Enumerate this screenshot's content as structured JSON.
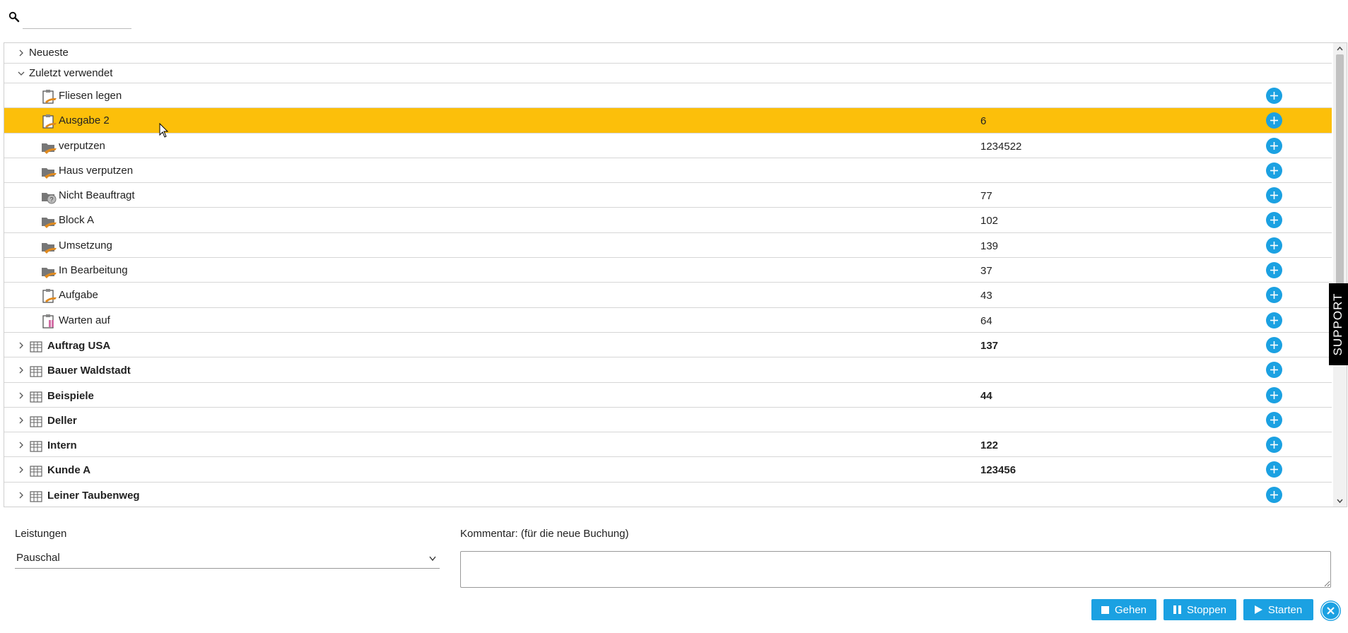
{
  "search": {
    "value": "",
    "placeholder": ""
  },
  "tree": {
    "groups": [
      {
        "label": "Neueste",
        "expanded": false
      },
      {
        "label": "Zuletzt verwendet",
        "expanded": true
      }
    ],
    "recent_items": [
      {
        "label": "Fliesen legen",
        "number": "",
        "icon": "clipboard-task-icon"
      },
      {
        "label": "Ausgabe 2",
        "number": "6",
        "icon": "clipboard-task-icon",
        "selected": true
      },
      {
        "label": "verputzen",
        "number": "1234522",
        "icon": "folder-task-icon"
      },
      {
        "label": "Haus verputzen",
        "number": "",
        "icon": "folder-task-icon"
      },
      {
        "label": "Nicht Beauftragt",
        "number": "77",
        "icon": "folder-question-icon"
      },
      {
        "label": "Block A",
        "number": "102",
        "icon": "folder-task-icon"
      },
      {
        "label": "Umsetzung",
        "number": "139",
        "icon": "folder-task-icon"
      },
      {
        "label": "In Bearbeitung",
        "number": "37",
        "icon": "folder-task-icon"
      },
      {
        "label": "Aufgabe",
        "number": "43",
        "icon": "clipboard-task-icon"
      },
      {
        "label": "Warten auf",
        "number": "64",
        "icon": "clipboard-waiting-icon"
      }
    ],
    "projects": [
      {
        "label": "Auftrag USA",
        "number": "137"
      },
      {
        "label": "Bauer Waldstadt",
        "number": ""
      },
      {
        "label": "Beispiele",
        "number": "44"
      },
      {
        "label": "Deller",
        "number": ""
      },
      {
        "label": "Intern",
        "number": "122"
      },
      {
        "label": "Kunde A",
        "number": "123456"
      },
      {
        "label": "Leiner Taubenweg",
        "number": ""
      }
    ]
  },
  "support_label": "SUPPORT",
  "form": {
    "services_label": "Leistungen",
    "services_value": "Pauschal",
    "comment_label": "Kommentar: (für die neue Buchung)",
    "comment_value": ""
  },
  "buttons": {
    "go": "Gehen",
    "stop": "Stoppen",
    "start": "Starten"
  },
  "colors": {
    "accent": "#1ba1e2",
    "selected_row": "#fcbf0a",
    "support_bg": "#000000"
  }
}
